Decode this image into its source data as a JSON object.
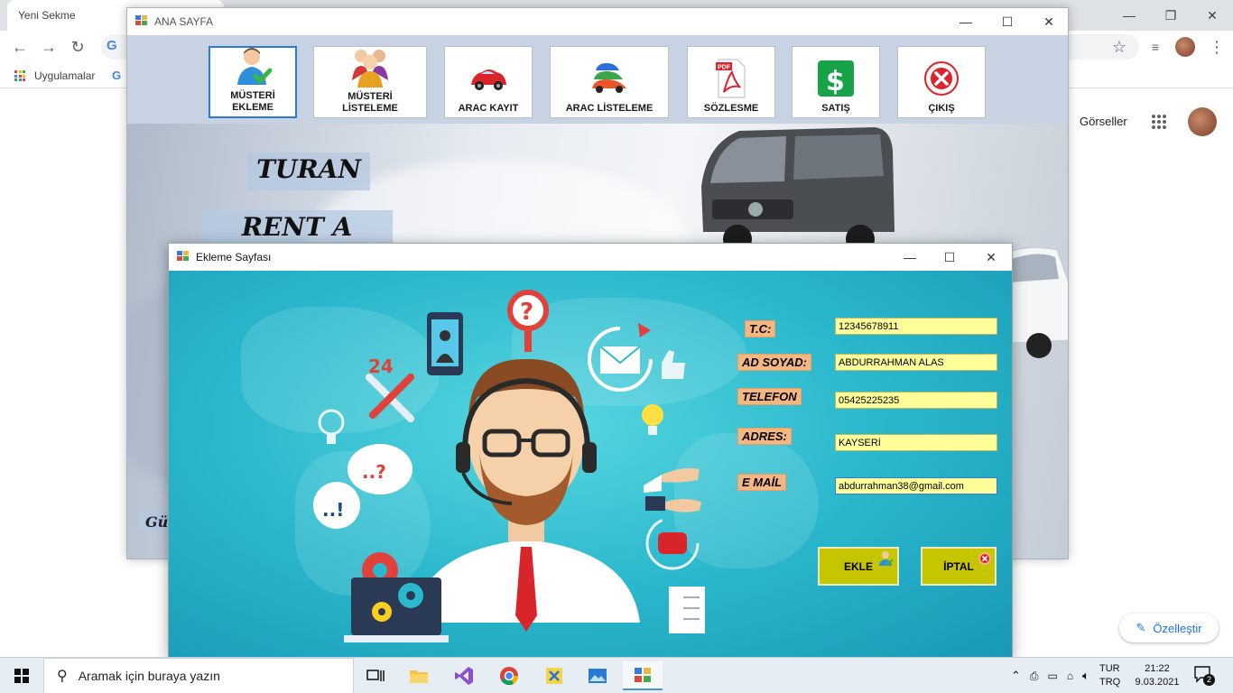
{
  "browser": {
    "tab_title": "Yeni Sekme",
    "bookmark_apps": "Uygulamalar",
    "google_images": "Görseller",
    "customize": "Özelleştir"
  },
  "main_window": {
    "title": "ANA SAYFA",
    "ribbon": [
      {
        "label": "MÜSTERİ\nEKLEME",
        "icon": "person-add-icon"
      },
      {
        "label": "MÜSTERİ\nLİSTELEME",
        "icon": "people-icon"
      },
      {
        "label": "ARAC KAYIT",
        "icon": "red-car-icon"
      },
      {
        "label": "ARAC LİSTELEME",
        "icon": "cars-stack-icon"
      },
      {
        "label": "SÖZLESME",
        "icon": "pdf-icon"
      },
      {
        "label": "SATIŞ",
        "icon": "dollar-icon"
      },
      {
        "label": "ÇIKIŞ",
        "icon": "exit-icon"
      }
    ],
    "brand_line1": "TURAN",
    "brand_line2": "RENT A CAR",
    "brand_bottom": "Gü"
  },
  "dialog": {
    "title": "Ekleme Sayfası",
    "fields": {
      "tc": {
        "label": "T.C:",
        "value": "12345678911"
      },
      "adsoyad": {
        "label": "AD SOYAD:",
        "value": "ABDURRAHMAN ALAS"
      },
      "telefon": {
        "label": "TELEFON",
        "value": "05425225235"
      },
      "adres": {
        "label": "ADRES:",
        "value": "KAYSERİ"
      },
      "email": {
        "label": "E MAİL",
        "value": "abdurrahman38@gmail.com"
      }
    },
    "add_button": "EKLE",
    "cancel_button": "İPTAL",
    "badge_24": "24"
  },
  "taskbar": {
    "search_placeholder": "Aramak için buraya yazın",
    "lang_line1": "TUR",
    "lang_line2": "TRQ",
    "time": "21:22",
    "date": "9.03.2021",
    "notif_count": "2"
  },
  "colors": {
    "ribbon_bg": "#c7d3e3",
    "label_bg": "#f5b782",
    "input_bg": "#ffff99",
    "button_bg": "#c6c600",
    "dialog_bg": "#2ab8cc"
  }
}
